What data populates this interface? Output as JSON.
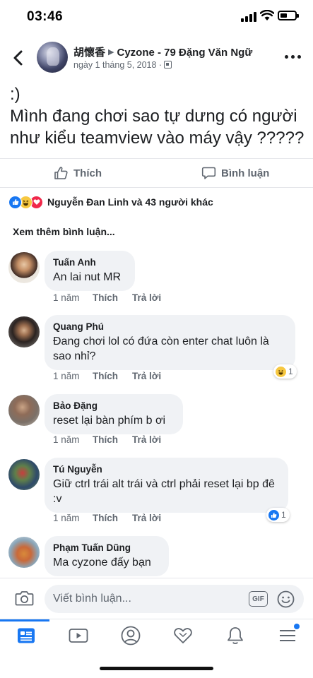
{
  "status_bar": {
    "time": "03:46"
  },
  "post": {
    "author": "胡懷香",
    "target": "Cyzone - 79 Đặng Văn Ngữ",
    "date": "ngày 1 tháng 5, 2018 ·",
    "body_line1": ":)",
    "body_line2": "Mình đang chơi sao tự dưng có người như kiểu teamview vào máy vậy ?????"
  },
  "actions": {
    "like_label": "Thích",
    "comment_label": "Bình luận"
  },
  "reactions": {
    "summary": "Nguyễn Đan Linh và 43 người khác",
    "types": [
      "like",
      "haha",
      "love"
    ]
  },
  "view_more": "Xem thêm bình luận...",
  "comment_actions": {
    "time": "1 năm",
    "like": "Thích",
    "reply": "Trả lời"
  },
  "comments": [
    {
      "name": "Tuấn Anh",
      "text": "An lai nut MR"
    },
    {
      "name": "Quang Phú",
      "text": "Đang chơi lol có đứa còn enter chat luôn là sao nhỉ?",
      "reaction": {
        "type": "haha",
        "count": "1"
      }
    },
    {
      "name": "Bảo Đặng",
      "text": "reset lại bàn phím b ơi"
    },
    {
      "name": "Tú Nguyễn",
      "text": "Giữ ctrl trái alt trái và ctrl phải reset lại bp đê :v",
      "reaction": {
        "type": "like",
        "count": "1"
      }
    },
    {
      "name": "Phạm Tuấn Dũng",
      "text": "Ma cyzone đấy bạn"
    }
  ],
  "write_comment": {
    "placeholder": "Viết bình luận...",
    "gif_label": "GIF"
  },
  "tabs": [
    "news-feed",
    "watch",
    "profile",
    "dating",
    "notifications",
    "menu"
  ],
  "colors": {
    "accent": "#1877f2",
    "bubble": "#f0f2f5",
    "secondary_text": "#606770",
    "love": "#f0284a",
    "haha": "#f7c841"
  }
}
